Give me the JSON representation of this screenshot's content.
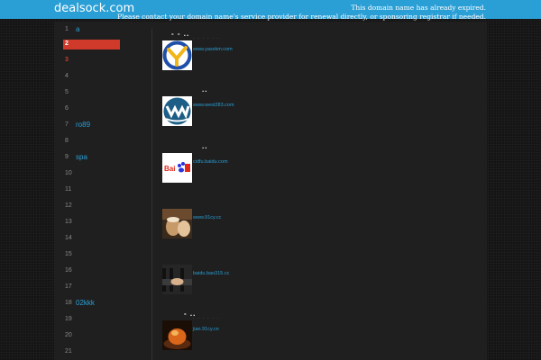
{
  "header": {
    "site_title": "dealsock.com",
    "notice_line1": "This domain name has already expired.",
    "notice_line2": "Please contact your domain name's service provider for renewal directly, or sponsoring registrar if needed."
  },
  "colors": {
    "brand_blue": "#2a9fd6",
    "active_red": "#cf3a2a",
    "page_background": "#141414",
    "panel_background": "#1f1f1f"
  },
  "sidebar": {
    "items": [
      {
        "num": "1",
        "label": "a"
      },
      {
        "num": "2",
        "label": ""
      },
      {
        "num": "3",
        "label": ""
      },
      {
        "num": "4",
        "label": ""
      },
      {
        "num": "5",
        "label": ""
      },
      {
        "num": "6",
        "label": ""
      },
      {
        "num": "7",
        "label": "ro89"
      },
      {
        "num": "8",
        "label": ""
      },
      {
        "num": "9",
        "label": "spa"
      },
      {
        "num": "10",
        "label": ""
      },
      {
        "num": "11",
        "label": ""
      },
      {
        "num": "12",
        "label": ""
      },
      {
        "num": "13",
        "label": ""
      },
      {
        "num": "14",
        "label": ""
      },
      {
        "num": "15",
        "label": ""
      },
      {
        "num": "16",
        "label": ""
      },
      {
        "num": "17",
        "label": ""
      },
      {
        "num": "18",
        "label": "02kkk"
      },
      {
        "num": "19",
        "label": ""
      },
      {
        "num": "20",
        "label": ""
      },
      {
        "num": "21",
        "label": ""
      }
    ],
    "active_index": 1
  },
  "entries": [
    {
      "title": "- - ..",
      "subtitle": ". . . . . .",
      "link": "www.yasxkm.com",
      "thumb": "yx-logo-icon"
    },
    {
      "title": "..",
      "subtitle": "",
      "link": "www.west283.com",
      "thumb": "w-logo-icon"
    },
    {
      "title": "..",
      "subtitle": "",
      "link": "cidfu.baidu.com",
      "thumb": "baidu-logo-icon"
    },
    {
      "title": "",
      "subtitle": "",
      "link": "www.91cy.cc",
      "thumb": "coffee-photo-icon"
    },
    {
      "title": "",
      "subtitle": "",
      "link": "baidu.bao315.cc",
      "thumb": "handshake-photo-icon"
    },
    {
      "title": "- ..",
      "subtitle": ". . . . . .",
      "link": "jian.91cy.cn",
      "thumb": "food-photo-icon"
    }
  ]
}
